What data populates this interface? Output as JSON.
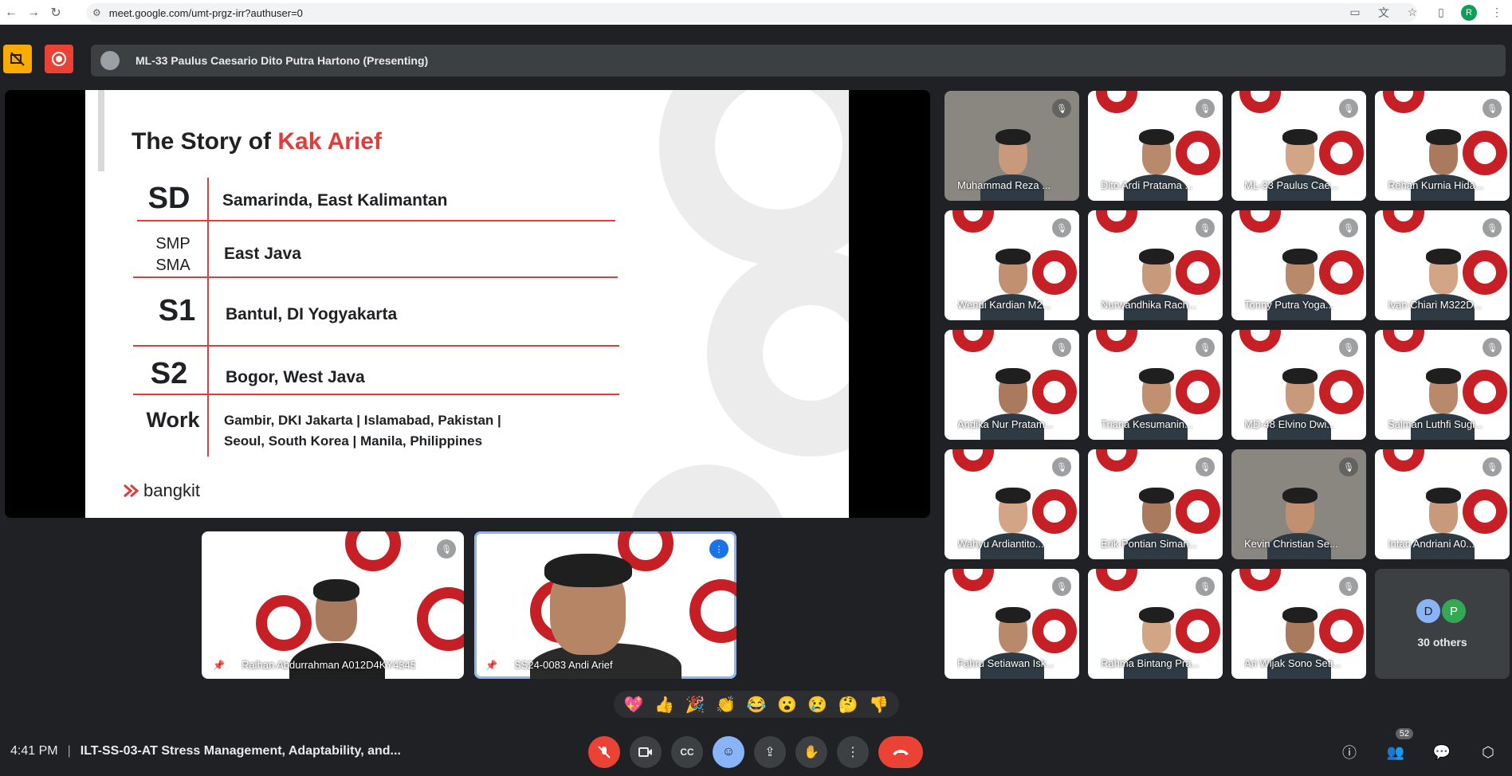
{
  "browser": {
    "url": "meet.google.com/umt-prgz-irr?authuser=0",
    "profile_initial": "R"
  },
  "presenter": {
    "name": "ML-33 Paulus Caesario Dito Putra Hartono (Presenting)"
  },
  "slide": {
    "title_prefix": "The Story of ",
    "title_highlight": "Kak Arief",
    "rows": [
      {
        "label": "SD",
        "value": "Samarinda, East Kalimantan"
      },
      {
        "label": "SMP\nSMA",
        "label_line1": "SMP",
        "label_line2": "SMA",
        "value": "East Java"
      },
      {
        "label": "S1",
        "value": "Bantul, DI Yogyakarta"
      },
      {
        "label": "S2",
        "value": "Bogor, West Java"
      },
      {
        "label": "Work",
        "value_line1": "Gambir, DKI Jakarta | Islamabad, Pakistan |",
        "value_line2": "Seoul, South Korea | Manila, Philippines"
      }
    ],
    "brand": "bangkit",
    "accent_color": "#e23b3b"
  },
  "pinned": [
    {
      "name": "Raihan Abdurrahman A012D4KY4345"
    },
    {
      "name": "SS24-0083 Andi Arief"
    }
  ],
  "participants": [
    {
      "name": "Muhammad Reza ..."
    },
    {
      "name": "Dito Ardi Pratama ..."
    },
    {
      "name": "ML-33 Paulus Cae..."
    },
    {
      "name": "Rehan Kurnia Hida..."
    },
    {
      "name": "Wendi Kardian M2..."
    },
    {
      "name": "Nurwandhika Rach..."
    },
    {
      "name": "Tonny Putra Yoga..."
    },
    {
      "name": "Ivan Chiari M322D..."
    },
    {
      "name": "Andika Nur Pratam..."
    },
    {
      "name": "Triana Kesumanin..."
    },
    {
      "name": "MD-48 Elvino Dwi..."
    },
    {
      "name": "Salman Luthfi Sugi..."
    },
    {
      "name": "Wahyu Ardiantito..."
    },
    {
      "name": "Erik Pontian Siman..."
    },
    {
      "name": "Kevin Christian Se..."
    },
    {
      "name": "Intan Andriani A0..."
    },
    {
      "name": "Fahru Setiawan Isk..."
    },
    {
      "name": "Rahma Bintang Pra..."
    },
    {
      "name": "Ari Wijak Sono Seti..."
    }
  ],
  "others": {
    "label": "30 others",
    "avatar1": "D",
    "avatar2": "P"
  },
  "reactions": [
    "💖",
    "👍",
    "🎉",
    "👏",
    "😂",
    "😮",
    "😢",
    "🤔",
    "👎"
  ],
  "bottom": {
    "time": "4:41 PM",
    "separator": "|",
    "meeting_title": "ILT-SS-03-AT Stress Management, Adaptability, and...",
    "people_count": "52"
  }
}
